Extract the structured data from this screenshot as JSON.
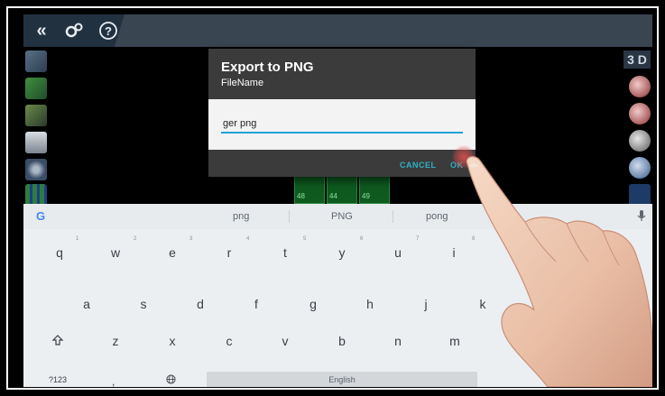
{
  "dialog": {
    "title": "Export to PNG",
    "subtitle": "FileName",
    "input_value": "ger png",
    "cancel_label": "CANCEL",
    "ok_label": "OK"
  },
  "tiles": [
    "48",
    "44",
    "49"
  ],
  "keyboard": {
    "suggestions": [
      "png",
      "PNG",
      "pong"
    ],
    "row1": [
      "q",
      "w",
      "e",
      "r",
      "t",
      "y",
      "u",
      "i"
    ],
    "row1_hints": [
      "1",
      "2",
      "3",
      "4",
      "5",
      "6",
      "7",
      "8"
    ],
    "row2": [
      "a",
      "s",
      "d",
      "f",
      "g",
      "h",
      "j",
      "k"
    ],
    "row3": [
      "z",
      "x",
      "c",
      "v",
      "b",
      "n",
      "m"
    ],
    "symbols_label": "?123",
    "comma_label": ",",
    "space_label": "English"
  },
  "right_panel": {
    "view_3d_label": "3 D"
  },
  "colors": {
    "accent": "#1fa2d8",
    "button_text": "#2fb0c7",
    "dialog_bg": "#3b3b3b"
  }
}
